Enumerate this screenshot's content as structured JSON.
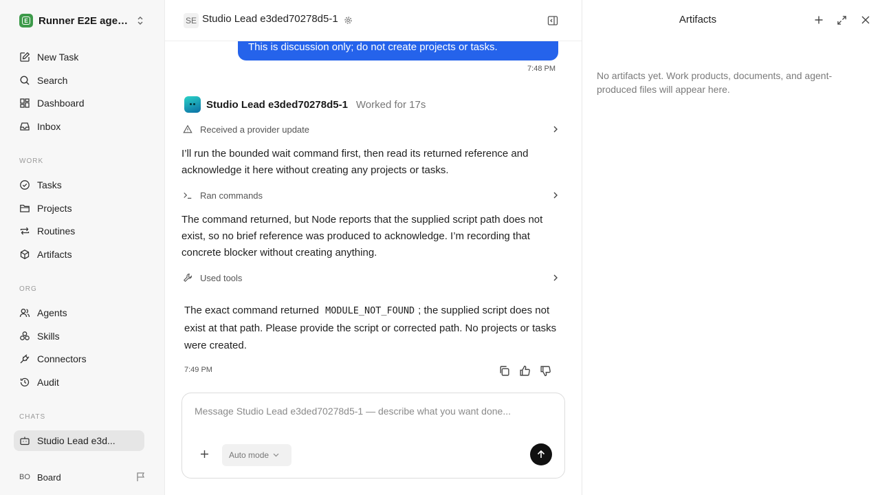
{
  "sidebar": {
    "workspace_name": "Runner E2E agen...",
    "workspace_logo": "E",
    "items": [
      {
        "label": "New Task",
        "icon": "pencil-square-icon"
      },
      {
        "label": "Search",
        "icon": "search-icon"
      },
      {
        "label": "Dashboard",
        "icon": "dashboard-icon"
      },
      {
        "label": "Inbox",
        "icon": "inbox-icon"
      }
    ],
    "work_section": "WORK",
    "work_items": [
      {
        "label": "Tasks",
        "icon": "check-circle-icon"
      },
      {
        "label": "Projects",
        "icon": "folder-icon"
      },
      {
        "label": "Routines",
        "icon": "repeat-icon"
      },
      {
        "label": "Artifacts",
        "icon": "box-icon"
      }
    ],
    "org_section": "ORG",
    "org_items": [
      {
        "label": "Agents",
        "icon": "users-icon"
      },
      {
        "label": "Skills",
        "icon": "skills-icon"
      },
      {
        "label": "Connectors",
        "icon": "plug-icon"
      },
      {
        "label": "Audit",
        "icon": "history-icon"
      }
    ],
    "chats_section": "CHATS",
    "chat_items": [
      {
        "label": "Studio Lead e3d...",
        "icon": "bot-icon",
        "active": true
      }
    ],
    "user": {
      "initials": "BO",
      "name": "Board"
    }
  },
  "chat": {
    "header": {
      "badge": "SE",
      "title": "Studio Lead e3ded70278d5-1"
    },
    "user_message": "This is discussion only; do not create projects or tasks.",
    "user_time": "7:48 PM",
    "agent_name": "Studio Lead e3ded70278d5-1",
    "worked_for": "Worked for 17s",
    "steps": [
      {
        "label": "Received a provider update",
        "icon": "alert-triangle-icon"
      },
      {
        "label": "Ran commands",
        "icon": "terminal-icon"
      },
      {
        "label": "Used tools",
        "icon": "wrench-icon"
      }
    ],
    "paragraphs": [
      "I’ll run the bounded wait command first, then read its returned reference and acknowledge it here without creating any projects or tasks.",
      "The command returned, but Node reports that the supplied script path does not exist, so no brief reference was produced to acknowledge. I’m recording that concrete blocker without creating anything."
    ],
    "final_prefix": "The exact command returned",
    "final_code": "MODULE_NOT_FOUND",
    "final_suffix": "; the supplied script does not exist at that path. Please provide the script or corrected path. No projects or tasks were created.",
    "final_time": "7:49 PM",
    "composer": {
      "placeholder": "Message Studio Lead e3ded70278d5-1 — describe what you want done...",
      "value": "",
      "mode": "Auto mode"
    }
  },
  "artifacts": {
    "title": "Artifacts",
    "empty": "No artifacts yet. Work products, documents, and agent-produced files will appear here."
  },
  "colors": {
    "accent": "#2563eb",
    "sidebar_bg": "#f7f7f7",
    "logo": "#3d9a4a"
  }
}
